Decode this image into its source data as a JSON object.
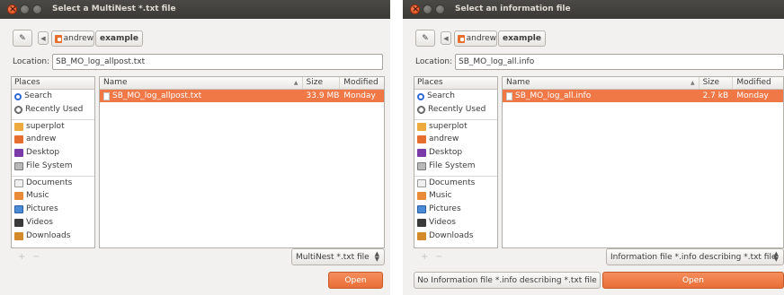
{
  "dialog1": {
    "title": "Select a MultiNest *.txt file",
    "breadcrumb": [
      "andrew",
      "example"
    ],
    "location_label": "Location:",
    "location_value": "SB_MO_log_allpost.txt",
    "places_header": "Places",
    "files_columns": [
      "Name",
      "Size",
      "Modified"
    ],
    "file": {
      "name": "SB_MO_log_allpost.txt",
      "size": "33.9 MB",
      "modified": "Monday"
    },
    "filter": "MultiNest *.txt file",
    "open_label": "Open"
  },
  "dialog2": {
    "title": "Select an information file",
    "breadcrumb": [
      "andrew",
      "example"
    ],
    "location_label": "Location:",
    "location_value": "SB_MO_log_all.info",
    "places_header": "Places",
    "files_columns": [
      "Name",
      "Size",
      "Modified"
    ],
    "file": {
      "name": "SB_MO_log_all.info",
      "size": "2.7 kB",
      "modified": "Monday"
    },
    "filter": "Information file *.info describing *.txt file",
    "no_info_label": "No Information file *.info describing *.txt file",
    "open_label": "Open"
  },
  "places": [
    {
      "label": "Search",
      "icon": "search-icon"
    },
    {
      "label": "Recently Used",
      "icon": "clock-icon"
    },
    {
      "label": "superplot",
      "icon": "folder-icon"
    },
    {
      "label": "andrew",
      "icon": "home-folder-icon"
    },
    {
      "label": "Desktop",
      "icon": "desktop-icon"
    },
    {
      "label": "File System",
      "icon": "drive-icon"
    },
    {
      "label": "Documents",
      "icon": "documents-icon"
    },
    {
      "label": "Music",
      "icon": "music-icon"
    },
    {
      "label": "Pictures",
      "icon": "pictures-icon"
    },
    {
      "label": "Videos",
      "icon": "videos-icon"
    },
    {
      "label": "Downloads",
      "icon": "downloads-icon"
    }
  ],
  "colors": {
    "accent": "#f07746",
    "titlebar": "#3d3c38",
    "window_bg": "#f2f1f0"
  }
}
